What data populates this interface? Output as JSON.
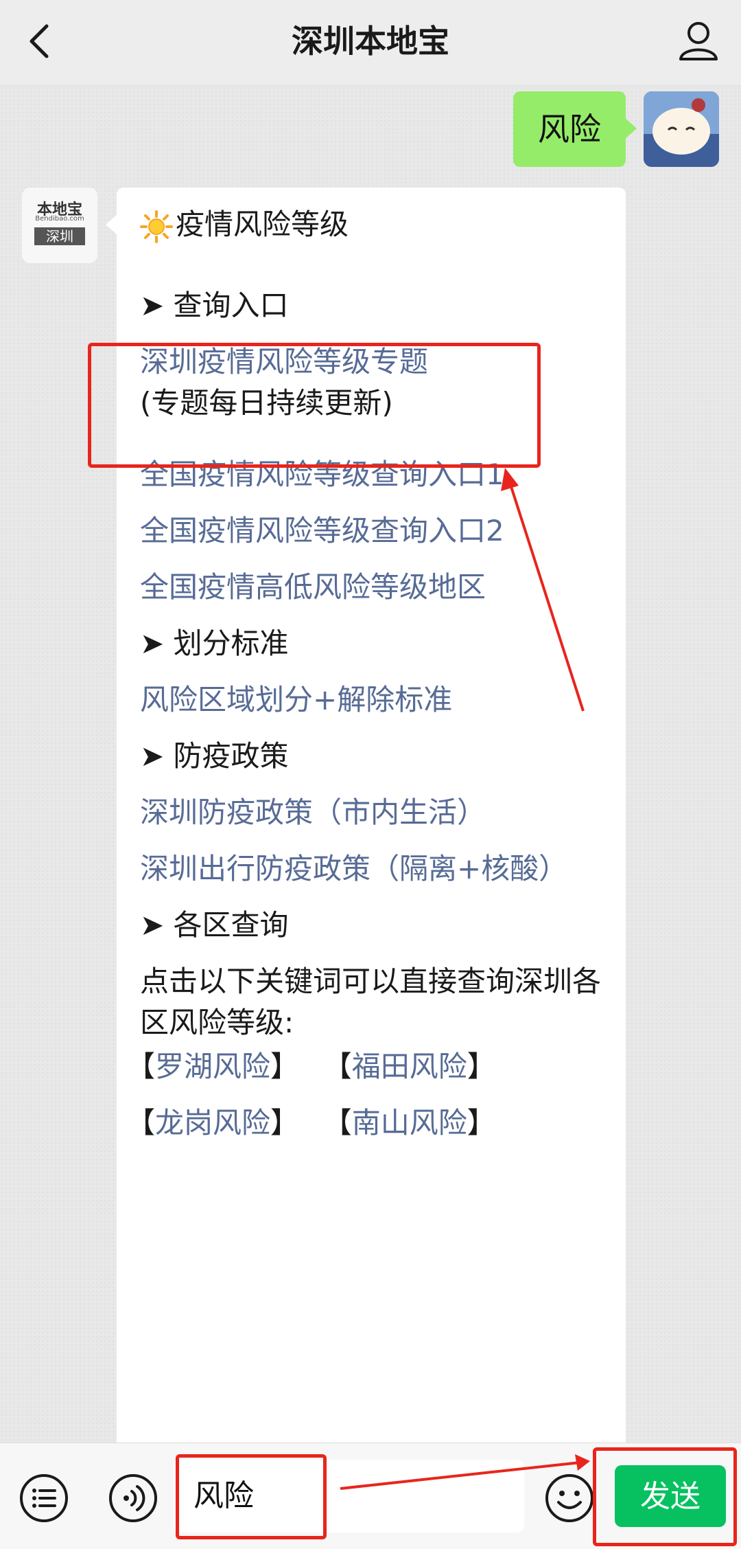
{
  "header": {
    "title": "深圳本地宝"
  },
  "user_message": {
    "text": "风险"
  },
  "bot_avatar": {
    "brand": "本地宝",
    "domain": "Bendibao.com",
    "city": "深圳"
  },
  "bot_message": {
    "heading_icon": "sun-emoji",
    "heading": "疫情风险等级",
    "section_query": "➤ 查询入口",
    "link_topic_title": "深圳疫情风险等级专题",
    "link_topic_note": "(专题每日持续更新)",
    "link_national_1": "全国疫情风险等级查询入口1",
    "link_national_2": "全国疫情风险等级查询入口2",
    "link_national_areas": "全国疫情高低风险等级地区",
    "section_standard": "➤ 划分标准",
    "link_standard": "风险区域划分+解除标准",
    "section_policy": "➤ 防疫政策",
    "link_policy_city": "深圳防疫政策（市内生活）",
    "link_policy_travel": "深圳出行防疫政策（隔离+核酸）",
    "section_district": "➤ 各区查询",
    "district_intro": "点击以下关键词可以直接查询深圳各区风险等级:",
    "district_row1_a": "罗湖风险",
    "district_row1_b": "福田风险",
    "district_row2_a": "龙岗风险",
    "district_row2_b": "南山风险",
    "bracket_open": "【",
    "bracket_close": "】"
  },
  "input": {
    "value": "风险"
  },
  "send_button": {
    "label": "发送"
  },
  "colors": {
    "link": "#576b95",
    "highlight": "#e8251c",
    "send": "#07c160",
    "user_bubble": "#95ec69"
  }
}
